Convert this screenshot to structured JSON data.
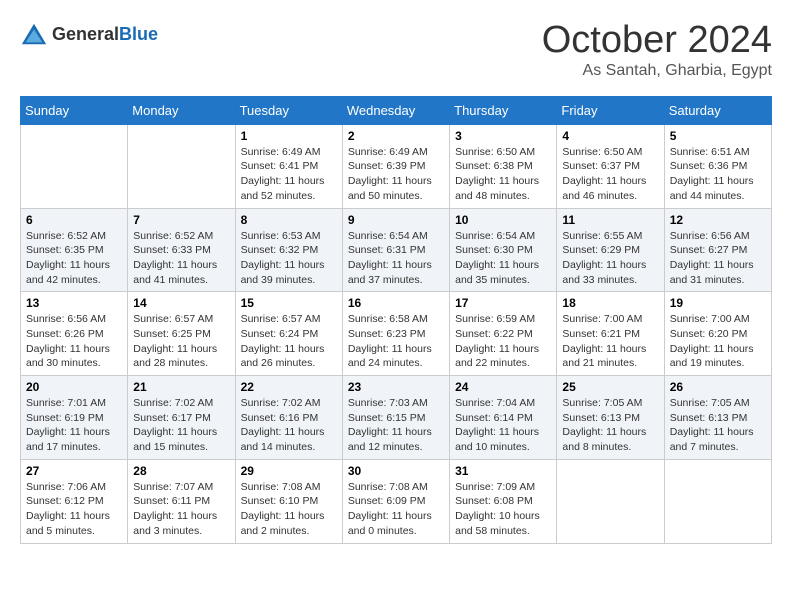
{
  "logo": {
    "general": "General",
    "blue": "Blue"
  },
  "title": {
    "month": "October 2024",
    "location": "As Santah, Gharbia, Egypt"
  },
  "headers": [
    "Sunday",
    "Monday",
    "Tuesday",
    "Wednesday",
    "Thursday",
    "Friday",
    "Saturday"
  ],
  "weeks": [
    [
      {
        "day": "",
        "content": ""
      },
      {
        "day": "",
        "content": ""
      },
      {
        "day": "1",
        "content": "Sunrise: 6:49 AM\nSunset: 6:41 PM\nDaylight: 11 hours and 52 minutes."
      },
      {
        "day": "2",
        "content": "Sunrise: 6:49 AM\nSunset: 6:39 PM\nDaylight: 11 hours and 50 minutes."
      },
      {
        "day": "3",
        "content": "Sunrise: 6:50 AM\nSunset: 6:38 PM\nDaylight: 11 hours and 48 minutes."
      },
      {
        "day": "4",
        "content": "Sunrise: 6:50 AM\nSunset: 6:37 PM\nDaylight: 11 hours and 46 minutes."
      },
      {
        "day": "5",
        "content": "Sunrise: 6:51 AM\nSunset: 6:36 PM\nDaylight: 11 hours and 44 minutes."
      }
    ],
    [
      {
        "day": "6",
        "content": "Sunrise: 6:52 AM\nSunset: 6:35 PM\nDaylight: 11 hours and 42 minutes."
      },
      {
        "day": "7",
        "content": "Sunrise: 6:52 AM\nSunset: 6:33 PM\nDaylight: 11 hours and 41 minutes."
      },
      {
        "day": "8",
        "content": "Sunrise: 6:53 AM\nSunset: 6:32 PM\nDaylight: 11 hours and 39 minutes."
      },
      {
        "day": "9",
        "content": "Sunrise: 6:54 AM\nSunset: 6:31 PM\nDaylight: 11 hours and 37 minutes."
      },
      {
        "day": "10",
        "content": "Sunrise: 6:54 AM\nSunset: 6:30 PM\nDaylight: 11 hours and 35 minutes."
      },
      {
        "day": "11",
        "content": "Sunrise: 6:55 AM\nSunset: 6:29 PM\nDaylight: 11 hours and 33 minutes."
      },
      {
        "day": "12",
        "content": "Sunrise: 6:56 AM\nSunset: 6:27 PM\nDaylight: 11 hours and 31 minutes."
      }
    ],
    [
      {
        "day": "13",
        "content": "Sunrise: 6:56 AM\nSunset: 6:26 PM\nDaylight: 11 hours and 30 minutes."
      },
      {
        "day": "14",
        "content": "Sunrise: 6:57 AM\nSunset: 6:25 PM\nDaylight: 11 hours and 28 minutes."
      },
      {
        "day": "15",
        "content": "Sunrise: 6:57 AM\nSunset: 6:24 PM\nDaylight: 11 hours and 26 minutes."
      },
      {
        "day": "16",
        "content": "Sunrise: 6:58 AM\nSunset: 6:23 PM\nDaylight: 11 hours and 24 minutes."
      },
      {
        "day": "17",
        "content": "Sunrise: 6:59 AM\nSunset: 6:22 PM\nDaylight: 11 hours and 22 minutes."
      },
      {
        "day": "18",
        "content": "Sunrise: 7:00 AM\nSunset: 6:21 PM\nDaylight: 11 hours and 21 minutes."
      },
      {
        "day": "19",
        "content": "Sunrise: 7:00 AM\nSunset: 6:20 PM\nDaylight: 11 hours and 19 minutes."
      }
    ],
    [
      {
        "day": "20",
        "content": "Sunrise: 7:01 AM\nSunset: 6:19 PM\nDaylight: 11 hours and 17 minutes."
      },
      {
        "day": "21",
        "content": "Sunrise: 7:02 AM\nSunset: 6:17 PM\nDaylight: 11 hours and 15 minutes."
      },
      {
        "day": "22",
        "content": "Sunrise: 7:02 AM\nSunset: 6:16 PM\nDaylight: 11 hours and 14 minutes."
      },
      {
        "day": "23",
        "content": "Sunrise: 7:03 AM\nSunset: 6:15 PM\nDaylight: 11 hours and 12 minutes."
      },
      {
        "day": "24",
        "content": "Sunrise: 7:04 AM\nSunset: 6:14 PM\nDaylight: 11 hours and 10 minutes."
      },
      {
        "day": "25",
        "content": "Sunrise: 7:05 AM\nSunset: 6:13 PM\nDaylight: 11 hours and 8 minutes."
      },
      {
        "day": "26",
        "content": "Sunrise: 7:05 AM\nSunset: 6:13 PM\nDaylight: 11 hours and 7 minutes."
      }
    ],
    [
      {
        "day": "27",
        "content": "Sunrise: 7:06 AM\nSunset: 6:12 PM\nDaylight: 11 hours and 5 minutes."
      },
      {
        "day": "28",
        "content": "Sunrise: 7:07 AM\nSunset: 6:11 PM\nDaylight: 11 hours and 3 minutes."
      },
      {
        "day": "29",
        "content": "Sunrise: 7:08 AM\nSunset: 6:10 PM\nDaylight: 11 hours and 2 minutes."
      },
      {
        "day": "30",
        "content": "Sunrise: 7:08 AM\nSunset: 6:09 PM\nDaylight: 11 hours and 0 minutes."
      },
      {
        "day": "31",
        "content": "Sunrise: 7:09 AM\nSunset: 6:08 PM\nDaylight: 10 hours and 58 minutes."
      },
      {
        "day": "",
        "content": ""
      },
      {
        "day": "",
        "content": ""
      }
    ]
  ]
}
